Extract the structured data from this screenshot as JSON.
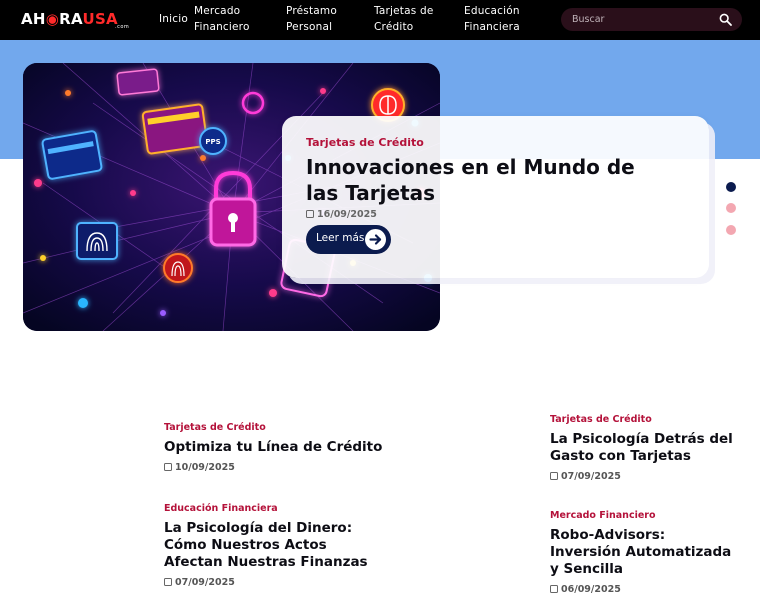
{
  "nav": {
    "logo_part1": "AH",
    "logo_part2": "RA",
    "logo_part3": "USA",
    "logo_sub": ".com",
    "links": [
      "Inicio",
      "Mercado\nFinanciero",
      "Préstamo\nPersonal",
      "Tarjetas de\nCrédito",
      "Educación\nFinanciera"
    ],
    "search_placeholder": "Buscar"
  },
  "hero": {
    "category": "Tarjetas de Crédito",
    "title": "Innovaciones en el Mundo de las Tarjetas",
    "date": "16/09/2025",
    "button_label": "Leer más",
    "image_labels": {
      "pps": "PPS"
    }
  },
  "slider": {
    "active_index": 0,
    "count": 3,
    "active_color": "#0b1b4e",
    "inactive_color": "#f3a7b1"
  },
  "articles": [
    {
      "category": "Tarjetas de Crédito",
      "title": "Optimiza tu Línea de Crédito",
      "date": "10/09/2025"
    },
    {
      "category": "Tarjetas de Crédito",
      "title": "La Psicología Detrás del Gasto con Tarjetas",
      "date": "07/09/2025"
    },
    {
      "category": "Educación Financiera",
      "title": "La Psicología del Dinero: Cómo Nuestros Actos Afectan Nuestras Finanzas",
      "date": "07/09/2025"
    },
    {
      "category": "Mercado Financiero",
      "title": "Robo-Advisors: Inversión Automatizada y Sencilla",
      "date": "06/09/2025"
    }
  ],
  "colors": {
    "navbar": "#000000",
    "hero_band": "#72a8ed",
    "accent_red": "#b4123a",
    "button_navy": "#0b1b4e"
  },
  "icons": [
    "search-icon",
    "calendar-icon",
    "arrow-right-icon",
    "padlock-icon",
    "fingerprint-icon",
    "brain-icon",
    "credit-card-icon"
  ]
}
